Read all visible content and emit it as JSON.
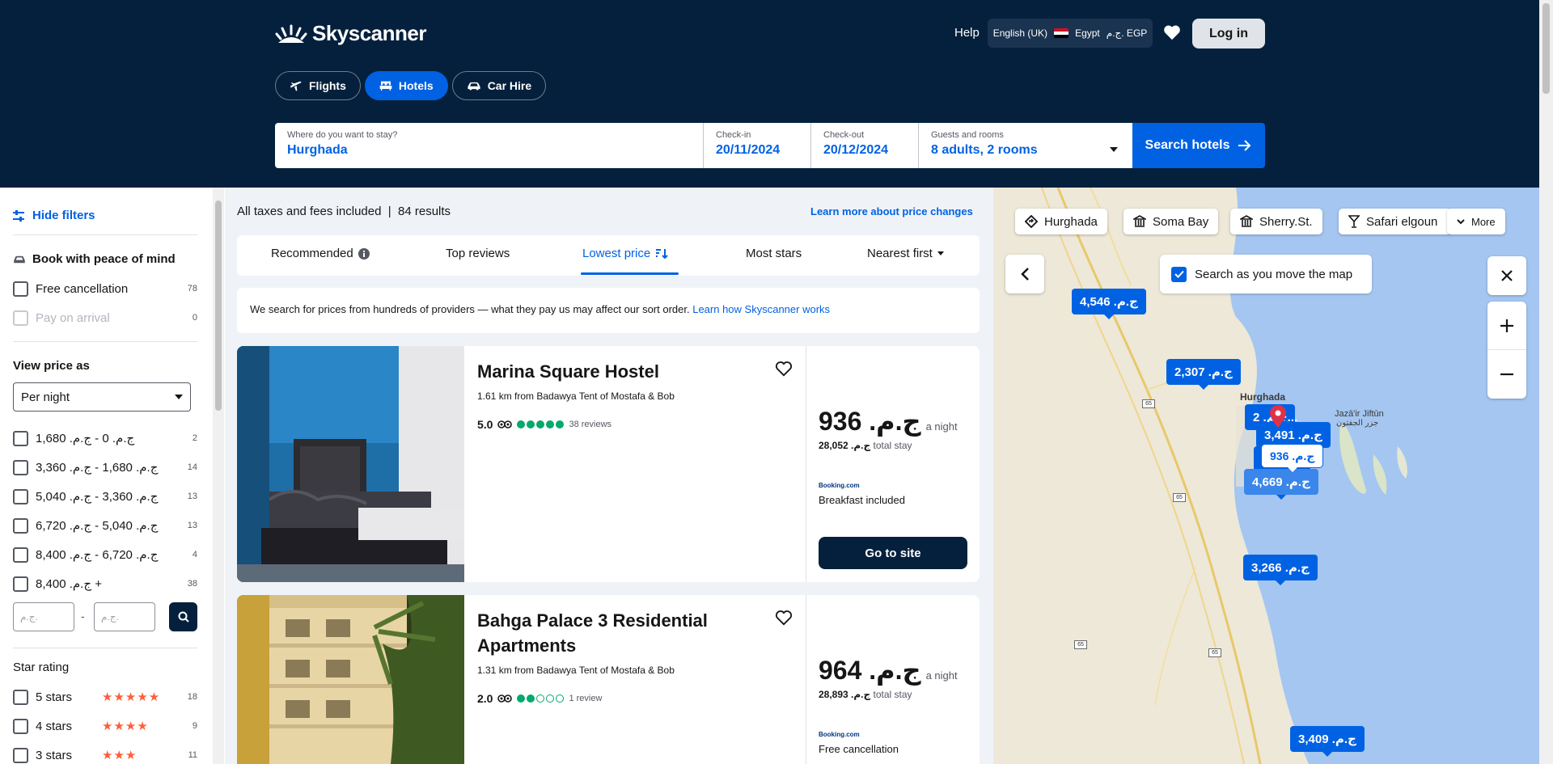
{
  "header": {
    "brand": "Skyscanner",
    "help": "Help",
    "language": "English (UK)",
    "country": "Egypt",
    "currency": "ج.م. EGP",
    "login": "Log in",
    "tabs": [
      {
        "label": "Flights",
        "icon": "plane-icon",
        "active": false
      },
      {
        "label": "Hotels",
        "icon": "bed-icon",
        "active": true
      },
      {
        "label": "Car Hire",
        "icon": "car-icon",
        "active": false
      }
    ]
  },
  "search": {
    "destination_label": "Where do you want to stay?",
    "destination_value": "Hurghada",
    "checkin_label": "Check-in",
    "checkin_value": "20/11/2024",
    "checkout_label": "Check-out",
    "checkout_value": "20/12/2024",
    "guests_label": "Guests and rooms",
    "guests_value": "8 adults, 2 rooms",
    "button": "Search hotels"
  },
  "filters": {
    "hide_label": "Hide filters",
    "peace_title": "Book with peace of mind",
    "peace_options": [
      {
        "label": "Free cancellation",
        "count": "78",
        "disabled": false
      },
      {
        "label": "Pay on arrival",
        "count": "0",
        "disabled": true
      }
    ],
    "price_title": "View price as",
    "price_mode": "Per night",
    "price_ranges": [
      {
        "label": "ج.م. 0 - ج.م. 1,680",
        "count": "2"
      },
      {
        "label": "ج.م. 1,680 - ج.م. 3,360",
        "count": "14"
      },
      {
        "label": "ج.م. 3,360 - ج.م. 5,040",
        "count": "13"
      },
      {
        "label": "ج.م. 5,040 - ج.م. 6,720",
        "count": "13"
      },
      {
        "label": "ج.م. 6,720 - ج.م. 8,400",
        "count": "4"
      },
      {
        "label": "ج.م. 8,400 +",
        "count": "38"
      }
    ],
    "min_placeholder": "ج.م.",
    "max_placeholder": "ج.م.",
    "range_separator": "-",
    "star_title": "Star rating",
    "star_options": [
      {
        "label": "5 stars",
        "stars": "★★★★★",
        "count": "18"
      },
      {
        "label": "4 stars",
        "stars": "★★★★",
        "count": "9"
      },
      {
        "label": "3 stars",
        "stars": "★★★",
        "count": "11"
      }
    ]
  },
  "results": {
    "summary": "All taxes and fees included  |  84 results",
    "learn_more": "Learn more about price changes",
    "sort_tabs": [
      "Recommended",
      "Top reviews",
      "Lowest price",
      "Most stars",
      "Nearest first"
    ],
    "active_sort": "Lowest price",
    "info_text": "We search for prices from hundreds of providers — what they pay us may affect our sort order. ",
    "info_link": "Learn how Skyscanner works",
    "hotels": [
      {
        "name": "Marina Square Hostel",
        "distance": "1.61 km from Badawya Tent of Mostafa & Bob",
        "rating": "5.0",
        "dots_filled": 5,
        "reviews": "38 reviews",
        "price": "ج.م. 936",
        "per_night": "a night",
        "total_amount": "ج.م. 28,052",
        "total_label": "total stay",
        "provider": "Booking.com",
        "perk": "Breakfast included",
        "cta": "Go to site"
      },
      {
        "name": "Bahga Palace 3 Residential Apartments",
        "distance": "1.31 km from Badawya Tent of Mostafa & Bob",
        "rating": "2.0",
        "dots_filled": 2,
        "reviews": "1 review",
        "price": "ج.م. 964",
        "per_night": "a night",
        "total_amount": "ج.م. 28,893",
        "total_label": "total stay",
        "provider": "Booking.com",
        "perk": "Free cancellation"
      }
    ]
  },
  "map": {
    "chips": [
      "Hurghada",
      "Soma Bay",
      "Sherry.St.",
      "Safari elgoun"
    ],
    "more": "More",
    "search_as_move": "Search as you move the map",
    "city_label": "Hurghada",
    "island_label": "Jazā'ir Jiftūn",
    "island_label_ar": "جزر الجفتون",
    "road_labels": [
      "65",
      "65",
      "65",
      "65"
    ],
    "pins": [
      "ج.م. 4,546",
      "ج.م. 2,307",
      "ج.م. 3,491",
      "ج.م. 936",
      "ج.م. 4,669",
      "ج.م. 3,266",
      "ج.م. 3,409",
      "ج.م. 2..."
    ]
  }
}
